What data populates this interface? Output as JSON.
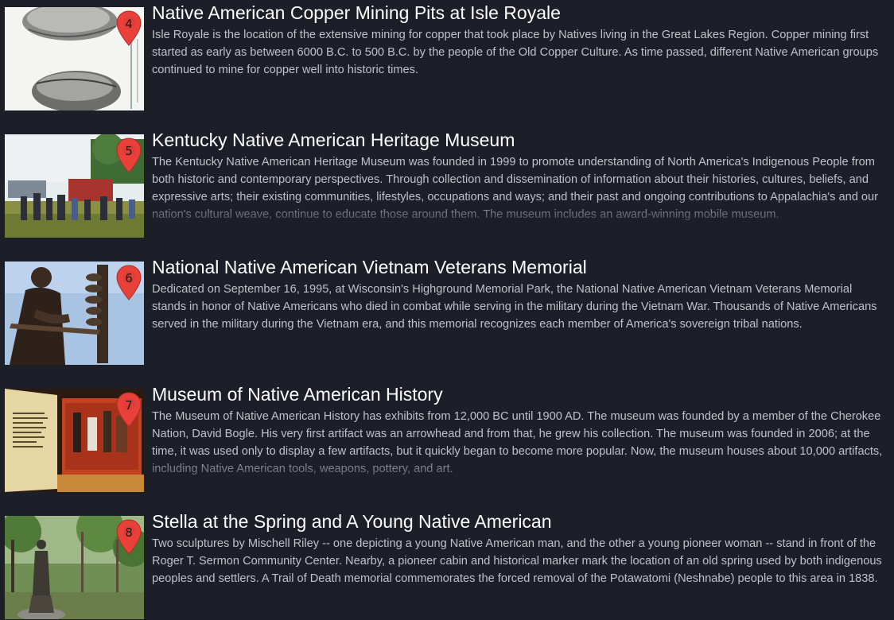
{
  "colors": {
    "background": "#1c1f28",
    "title": "#ffffff",
    "description": "#bfc2c9",
    "pin": "#e8413a"
  },
  "places": [
    {
      "marker": "4",
      "title": "Native American Copper Mining Pits at Isle Royale",
      "description": "Isle Royale is the location of the extensive mining for copper that took place by Natives living in the Great Lakes Region. Copper mining first started as early as between 6000 B.C. to 500 B.C. by the people of the Old Copper Culture. As time passed, different Native American groups continued to mine for copper well into historic times.",
      "thumbnail_icon": "stone-tools-photo-icon"
    },
    {
      "marker": "5",
      "title": "Kentucky Native American Heritage Museum",
      "description": "The Kentucky Native American Heritage Museum was founded in 1999 to promote understanding of North America's Indigenous People from both historic and contemporary perspectives. Through collection and dissemination of information about their histories, cultures, beliefs, and expressive arts; their existing communities, lifestyles, occupations and ways; and their past and ongoing contributions to Appalachia's and our nation's cultural weave, continue to educate those around them. The museum includes an award-winning mobile museum.",
      "thumbnail_icon": "festival-crowd-photo-icon"
    },
    {
      "marker": "6",
      "title": "National Native American Vietnam Veterans Memorial",
      "description": "Dedicated on September 16, 1995, at Wisconsin's Highground Memorial Park, the National Native American Vietnam Veterans Memorial stands in honor of Native Americans who died in combat while serving in the military during the Vietnam War. Thousands of Native Americans served in the military during the Vietnam era, and this memorial recognizes each member of America's sovereign tribal nations.",
      "thumbnail_icon": "bronze-statue-photo-icon"
    },
    {
      "marker": "7",
      "title": "Museum of Native American History",
      "description": "The Museum of Native American History has exhibits from 12,000 BC until 1900 AD. The museum was founded by a member of the Cherokee Nation, David Bogle. His very first artifact was an arrowhead and from that, he grew his collection. The museum was founded in 2006; at the time, it was used only to display a few artifacts, but it quickly began to become more popular. Now, the museum houses about 10,000 artifacts, including Native American tools, weapons, pottery, and art.",
      "thumbnail_icon": "museum-exhibit-photo-icon"
    },
    {
      "marker": "8",
      "title": "Stella at the Spring and A Young Native American",
      "description": "Two sculptures by Mischell Riley -- one depicting a young Native American man, and the other a young pioneer woman -- stand in front of the Roger T. Sermon Community Center. Nearby, a pioneer cabin and historical marker mark the location of an old spring used by both indigenous peoples and settlers. A Trail of Death memorial commemorates the forced removal of the Potawatomi (Neshnabe) people to this area in 1838.",
      "thumbnail_icon": "garden-sculpture-photo-icon"
    }
  ]
}
